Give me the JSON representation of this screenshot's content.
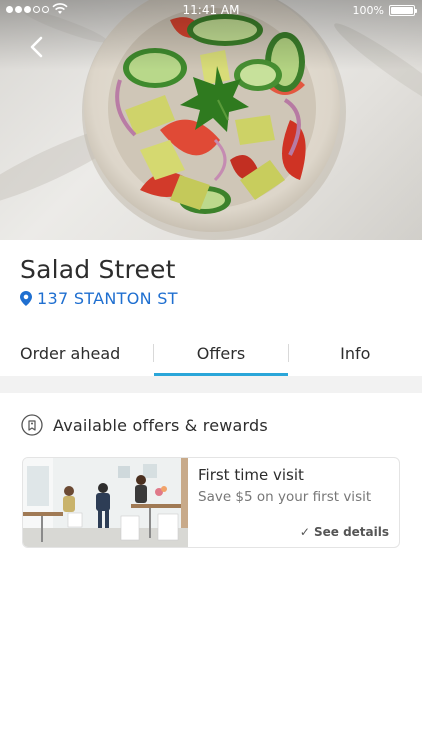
{
  "status_bar": {
    "time": "11:41 AM",
    "battery": "100%"
  },
  "hero": {
    "image": "salad-bowl-photo"
  },
  "nav": {
    "back_icon": "chevron-left-icon"
  },
  "restaurant": {
    "name": "Salad Street",
    "address": "137 STANTON ST",
    "address_icon": "location-pin-icon"
  },
  "tabs": [
    {
      "label": "Order ahead",
      "active": false
    },
    {
      "label": "Offers",
      "active": true
    },
    {
      "label": "Info",
      "active": false
    }
  ],
  "offers_section": {
    "icon": "reward-tag-icon",
    "title": "Available offers & rewards"
  },
  "offers": [
    {
      "image": "restaurant-interior-photo",
      "title": "First time visit",
      "description": "Save $5 on your first visit",
      "details_label": "See details",
      "details_icon": "check-icon"
    }
  ],
  "colors": {
    "accent_blue": "#1f6fd0",
    "tab_underline": "#2aa6d9"
  }
}
